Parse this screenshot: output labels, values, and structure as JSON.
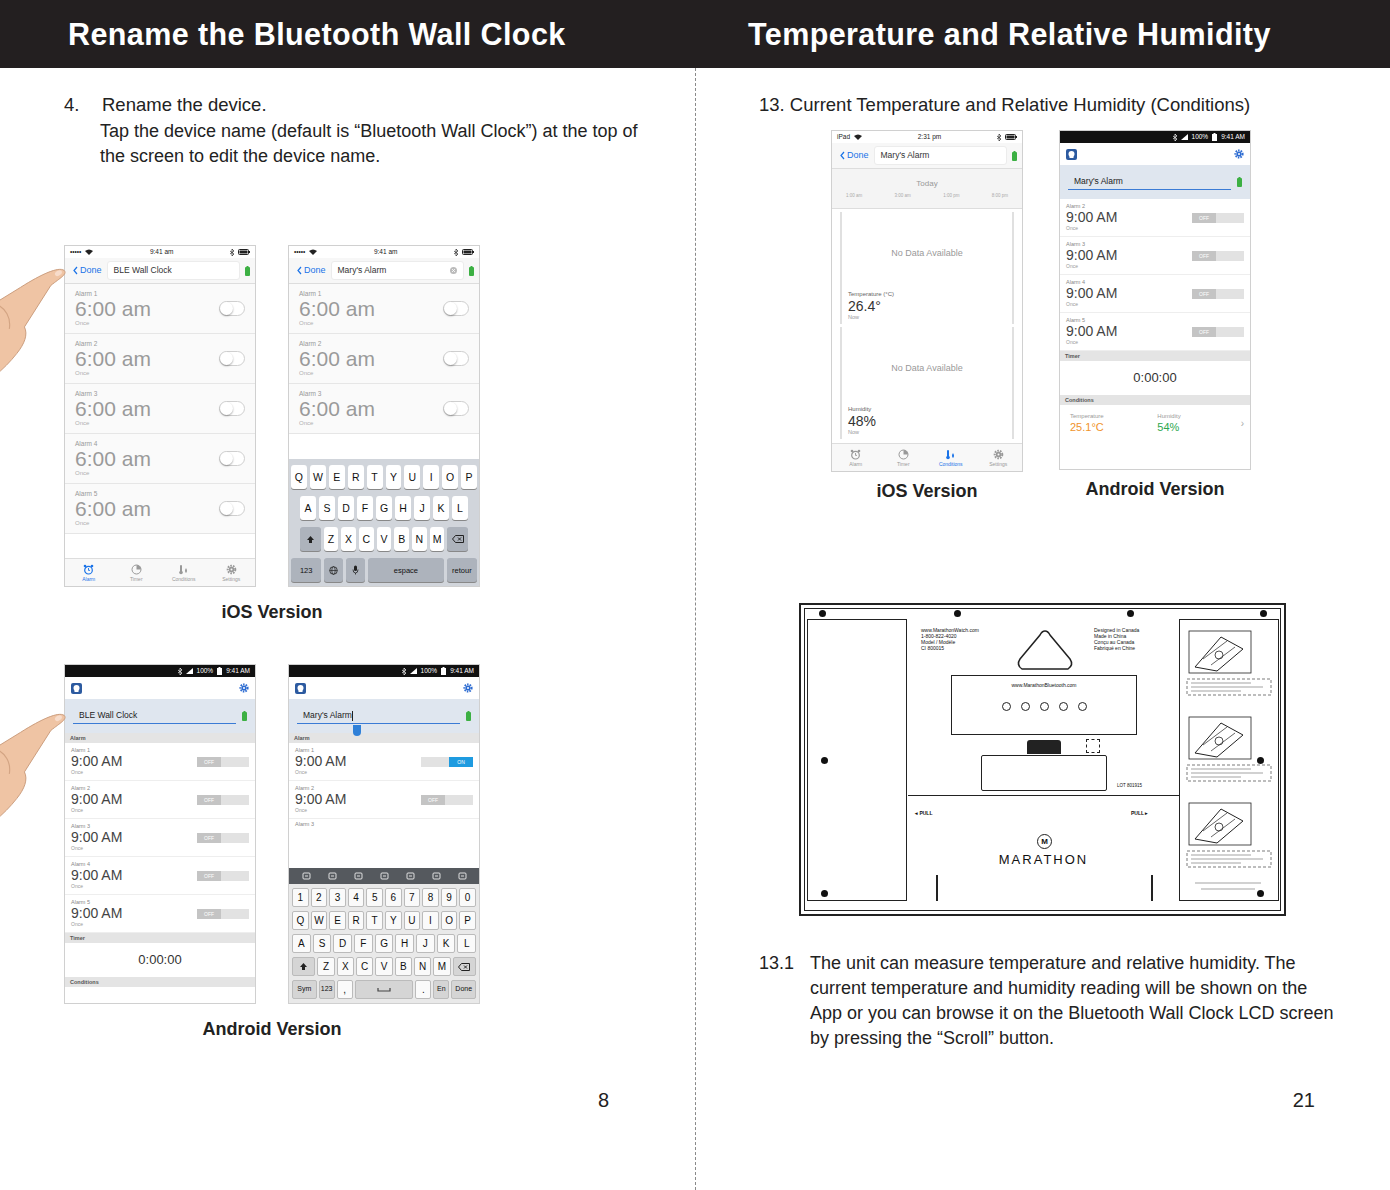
{
  "left_page": {
    "title": "Rename the Bluetooth Wall Clock",
    "step_number": "4.",
    "step_heading": "Rename the device.",
    "step_body": "Tap the device name (default is “Bluetooth Wall Clock”) at the top of the screen to edit the device name.",
    "figures": [
      {
        "caption": "iOS Version",
        "screens": [
          {
            "platform": "ios",
            "hand": true,
            "status": {
              "carrier": "•••••",
              "time": "9:41 am"
            },
            "header": {
              "back": "Done",
              "name": "BLE Wall Clock",
              "editing": false
            },
            "sections": [
              {
                "kind": "alarm",
                "label": "Alarm 1",
                "time": "6:00 am",
                "repeat": "Once",
                "on": false
              },
              {
                "kind": "alarm",
                "label": "Alarm 2",
                "time": "6:00 am",
                "repeat": "Once",
                "on": false
              },
              {
                "kind": "alarm",
                "label": "Alarm 3",
                "time": "6:00 am",
                "repeat": "Once",
                "on": false
              },
              {
                "kind": "alarm",
                "label": "Alarm 4",
                "time": "6:00 am",
                "repeat": "Once",
                "on": false
              },
              {
                "kind": "alarm",
                "label": "Alarm 5",
                "time": "6:00 am",
                "repeat": "Once",
                "on": false
              }
            ],
            "tabs": [
              {
                "label": "Alarm",
                "selected": true
              },
              {
                "label": "Timer",
                "selected": false
              },
              {
                "label": "Conditions",
                "selected": false
              },
              {
                "label": "Settings",
                "selected": false
              }
            ]
          },
          {
            "platform": "ios",
            "hand": false,
            "status": {
              "carrier": "•••••",
              "time": "9:41 am"
            },
            "header": {
              "back": "Done",
              "name": "Mary's Alarm",
              "editing": true
            },
            "sections": [
              {
                "kind": "alarm",
                "label": "Alarm 1",
                "time": "6:00 am",
                "repeat": "Once",
                "on": false
              },
              {
                "kind": "alarm",
                "label": "Alarm 2",
                "time": "6:00 am",
                "repeat": "Once",
                "on": false
              },
              {
                "kind": "alarm",
                "label": "Alarm 3",
                "time": "6:00 am",
                "repeat": "Once",
                "on": false
              },
              {
                "kind": "keyboard",
                "rows": [
                  [
                    "Q",
                    "W",
                    "E",
                    "R",
                    "T",
                    "Y",
                    "U",
                    "I",
                    "O",
                    "P"
                  ],
                  [
                    "A",
                    "S",
                    "D",
                    "F",
                    "G",
                    "H",
                    "J",
                    "K",
                    "L"
                  ],
                  [
                    {
                      "kind": "shift"
                    },
                    "Z",
                    "X",
                    "C",
                    "V",
                    "B",
                    "N",
                    "M",
                    {
                      "kind": "delete"
                    }
                  ],
                  [
                    "123",
                    {
                      "kind": "globe"
                    },
                    {
                      "kind": "mic"
                    },
                    "espace",
                    "retour"
                  ]
                ]
              }
            ],
            "tabs": []
          }
        ]
      },
      {
        "caption": "Android Version",
        "screens": [
          {
            "platform": "android",
            "hand": true,
            "status": {
              "battery": "100%",
              "time": "9:41 AM"
            },
            "header": {
              "name": "BLE Wall Clock",
              "editing": false
            },
            "sections": [
              {
                "kind": "subheader",
                "text": "Alarm"
              },
              {
                "kind": "alarm",
                "label": "Alarm 1",
                "time": "9:00 AM",
                "repeat": "Once",
                "on": false,
                "switch_text": "OFF"
              },
              {
                "kind": "alarm",
                "label": "Alarm 2",
                "time": "9:00 AM",
                "repeat": "Once",
                "on": false,
                "switch_text": "OFF"
              },
              {
                "kind": "alarm",
                "label": "Alarm 3",
                "time": "9:00 AM",
                "repeat": "Once",
                "on": false,
                "switch_text": "OFF"
              },
              {
                "kind": "alarm",
                "label": "Alarm 4",
                "time": "9:00 AM",
                "repeat": "Once",
                "on": false,
                "switch_text": "OFF"
              },
              {
                "kind": "alarm",
                "label": "Alarm 5",
                "time": "9:00 AM",
                "repeat": "Once",
                "on": false,
                "switch_text": "OFF"
              },
              {
                "kind": "subheader",
                "text": "Timer"
              },
              {
                "kind": "timer",
                "value": "0:00:00"
              },
              {
                "kind": "subheader",
                "text": "Conditions"
              }
            ],
            "tabs": []
          },
          {
            "platform": "android",
            "hand": false,
            "status": {
              "battery": "100%",
              "time": "9:41 AM"
            },
            "header": {
              "name": "Mary's Alarm",
              "editing": true
            },
            "sections": [
              {
                "kind": "subheader",
                "text": "Alarm"
              },
              {
                "kind": "alarm",
                "label": "Alarm 1",
                "time": "9:00 AM",
                "repeat": "Once",
                "on": true,
                "switch_text": "ON"
              },
              {
                "kind": "alarm",
                "label": "Alarm 2",
                "time": "9:00 AM",
                "repeat": "Once",
                "on": false,
                "switch_text": "OFF"
              },
              {
                "kind": "alarm-label",
                "label": "Alarm 3"
              },
              {
                "kind": "keyboard",
                "rows": [
                  [
                    "1",
                    "2",
                    "3",
                    "4",
                    "5",
                    "6",
                    "7",
                    "8",
                    "9",
                    "0"
                  ],
                  [
                    "Q",
                    "W",
                    "E",
                    "R",
                    "T",
                    "Y",
                    "U",
                    "I",
                    "O",
                    "P"
                  ],
                  [
                    "A",
                    "S",
                    "D",
                    "F",
                    "G",
                    "H",
                    "J",
                    "K",
                    "L"
                  ],
                  [
                    {
                      "kind": "shift"
                    },
                    "Z",
                    "X",
                    "C",
                    "V",
                    "B",
                    "N",
                    "M",
                    {
                      "kind": "delete"
                    }
                  ],
                  [
                    "Sym",
                    "123",
                    ",",
                    {
                      "kind": "space"
                    },
                    ".",
                    "En",
                    "Done"
                  ]
                ]
              }
            ],
            "tabs": []
          }
        ]
      }
    ],
    "page_number": "8"
  },
  "right_page": {
    "title": "Temperature and Relative Humidity",
    "step_heading": "13. Current Temperature and Relative Humidity (Conditions)",
    "figures": [
      {
        "caption": "iOS Version",
        "screen": {
          "platform": "ios",
          "hand": false,
          "status": {
            "carrier": "iPad",
            "time": "2:31 pm"
          },
          "header": {
            "back": "Done",
            "name": "Mary's Alarm",
            "editing": false
          },
          "sections": [
            {
              "kind": "date-strip",
              "day": "Today",
              "ticks": [
                "1:00 am",
                "3:00 am",
                "1:00 pm",
                "8:00 pm"
              ]
            },
            {
              "kind": "reading",
              "message": "No Data Available",
              "label": "Temperature (°C)",
              "value": "26.4°",
              "sub": "Now"
            },
            {
              "kind": "reading",
              "message": "No Data Available",
              "label": "Humidity",
              "value": "48%",
              "sub": "Now"
            }
          ],
          "tabs": [
            {
              "label": "Alarm",
              "selected": false
            },
            {
              "label": "Timer",
              "selected": false
            },
            {
              "label": "Conditions",
              "selected": true
            },
            {
              "label": "Settings",
              "selected": false
            }
          ]
        }
      },
      {
        "caption": "Android Version",
        "screen": {
          "platform": "android",
          "hand": false,
          "status": {
            "battery": "100%",
            "time": "9:41 AM"
          },
          "header": {
            "name": "Mary's Alarm",
            "editing": false
          },
          "sections": [
            {
              "kind": "alarm",
              "label": "Alarm 2",
              "time": "9:00 AM",
              "repeat": "Once",
              "on": false,
              "switch_text": "OFF"
            },
            {
              "kind": "alarm",
              "label": "Alarm 3",
              "time": "9:00 AM",
              "repeat": "Once",
              "on": false,
              "switch_text": "OFF"
            },
            {
              "kind": "alarm",
              "label": "Alarm 4",
              "time": "9:00 AM",
              "repeat": "Once",
              "on": false,
              "switch_text": "OFF"
            },
            {
              "kind": "alarm",
              "label": "Alarm 5",
              "time": "9:00 AM",
              "repeat": "Once",
              "on": false,
              "switch_text": "OFF"
            },
            {
              "kind": "subheader",
              "text": "Timer"
            },
            {
              "kind": "timer",
              "value": "0:00:00"
            },
            {
              "kind": "subheader",
              "text": "Conditions"
            },
            {
              "kind": "conditions",
              "items": [
                {
                  "label": "Temperature",
                  "value": "25.1°C",
                  "color": "#f0932b"
                },
                {
                  "label": "Humidity",
                  "value": "54%",
                  "color": "#2ea84f"
                }
              ],
              "more": "›"
            }
          ],
          "tabs": []
        }
      }
    ],
    "clock": {
      "info_left": [
        "www.MarathonWatch.com",
        "1-800-822-4020",
        "Model / Modèle",
        "CI 800015"
      ],
      "info_right": [
        "Designed in Canada",
        "Made in China",
        "Conçu au Canada",
        "Fabriqué en Chine"
      ],
      "website": "www.MarathonBluetooth.com",
      "lot": "LOT 801915",
      "pull_left": "◂ PULL",
      "pull_right": "PULL ▸",
      "logo": "M",
      "brand": "MARATHON"
    },
    "note": {
      "number": "13.1",
      "body": "The unit can measure temperature and relative humidity. The current temperature and humidity reading will be shown on the App or you can browse it on the Bluetooth Wall Clock LCD screen by pressing the “Scroll” button."
    },
    "page_number": "21"
  }
}
